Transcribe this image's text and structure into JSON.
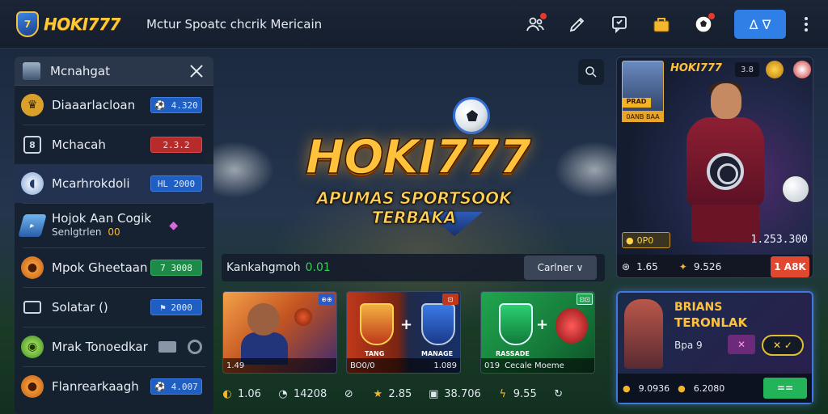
{
  "header": {
    "brand": "HOKI777",
    "nav_text": "Mctur Spoatc chcrik Mericain",
    "alert_button_label": "Δ ∇"
  },
  "sidebar": {
    "title": "Mcnahgat",
    "items": [
      {
        "label": "Diaaarlacloan",
        "badge": "⚽ 4.320",
        "badge_color": "blue",
        "icon": "trophy-icon"
      },
      {
        "label": "Mchacah",
        "badge": "2.3.2",
        "badge_color": "red",
        "icon": "calendar-icon"
      },
      {
        "label": "Mcarhrokdoli",
        "badge": "HL 2000",
        "badge_color": "blue",
        "icon": "rugby-icon"
      },
      {
        "label": "Hojok Aan Cogik",
        "sub": "Senlgtrlen",
        "sub_value": "00",
        "badge": "",
        "icon": "blimp-icon"
      },
      {
        "label": "Mpok Gheetaan",
        "badge": "7 3008",
        "badge_color": "green",
        "icon": "basketball-icon"
      },
      {
        "label": "Solatar ()",
        "badge": "⚑ 2000",
        "badge_color": "blue",
        "icon": "ticket-icon"
      },
      {
        "label": "Mrak Tonoedkar",
        "badge": "",
        "icon": "tennis-icon"
      },
      {
        "label": "Flanrearkaagh",
        "badge": "⚽ 4.007",
        "badge_color": "blue",
        "icon": "basketball-icon"
      }
    ]
  },
  "hero": {
    "title": "HOKI777",
    "subtitle": "APUMAS SPORTSOOK TERBAKA"
  },
  "player_card": {
    "brand": "HOKI777",
    "tag": "3.8",
    "mini_label": "PRAD",
    "mini_caption": "0ANB BAA",
    "left_value": "0P0",
    "right_value": "1.253.300",
    "stat_left": "1.65",
    "stat_mid": "9.526",
    "bet_button": "1 A8K"
  },
  "live": {
    "label": "Kankahgmoh",
    "time": "0.01",
    "select_label": "Carlner"
  },
  "tiles": [
    {
      "corner": "⊕⊕",
      "foot_left": "1.49",
      "foot_right": ""
    },
    {
      "corner": "⊡",
      "team_a": "TANG",
      "team_b": "MANAGE",
      "foot_left": "BO0/0",
      "foot_right": "1.089"
    },
    {
      "corner": "⊡⊡",
      "team_a": "RASSADE",
      "foot_left": "019",
      "foot_right": "Cecale Moeme"
    }
  ],
  "promo": {
    "line1": "BRIANS",
    "line2": "TERONLAK",
    "line3": "Bpa 9",
    "foot_left": "9.0936",
    "foot_mid": "6.2080",
    "go_label": "=="
  },
  "stats": [
    {
      "icon": "thumbs-up-icon",
      "value": "1.06"
    },
    {
      "icon": "timer-icon",
      "value": "14208"
    },
    {
      "icon": "link-icon",
      "value": ""
    },
    {
      "icon": "star-icon",
      "value": "2.85"
    },
    {
      "icon": "gamepad-icon",
      "value": "38.706"
    },
    {
      "icon": "lightning-icon",
      "value": "9.55"
    },
    {
      "icon": "refresh-icon",
      "value": ""
    }
  ]
}
